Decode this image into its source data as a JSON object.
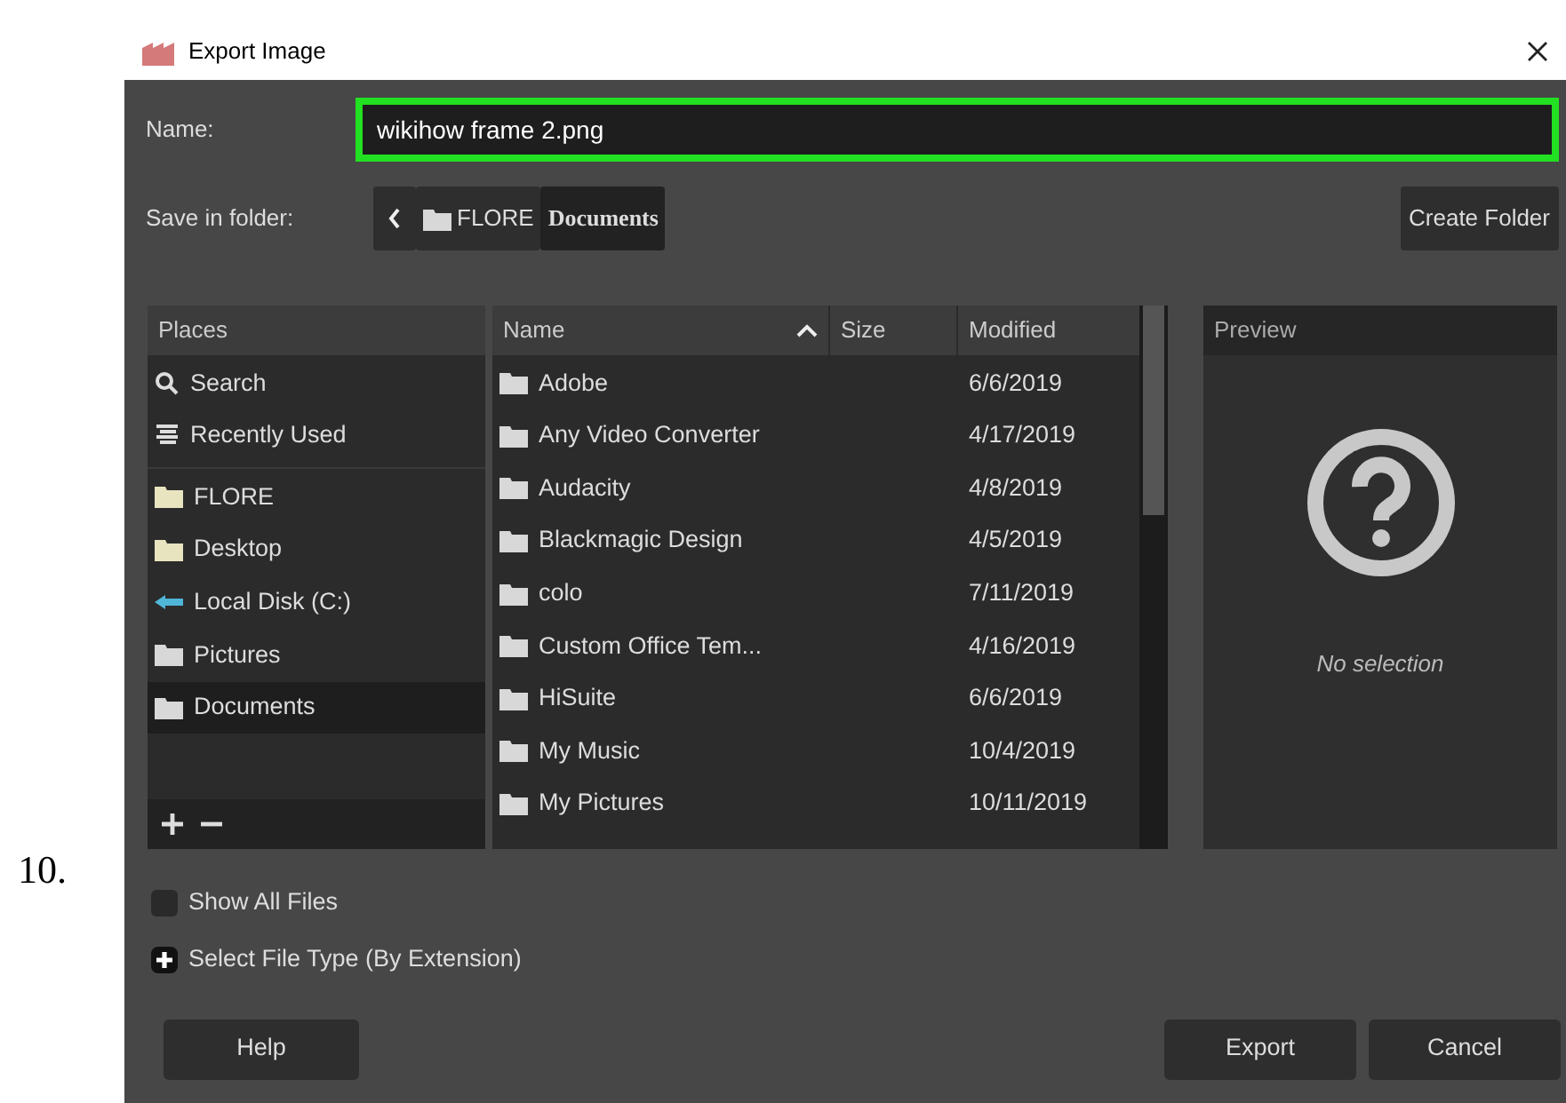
{
  "step_number": "10.",
  "window": {
    "title": "Export Image"
  },
  "name_field": {
    "label": "Name:",
    "value": "wikihow frame 2.png",
    "focused": true
  },
  "folder_bar": {
    "label": "Save in folder:",
    "path": [
      {
        "label": "FLORE",
        "kind": "folder",
        "selected": false
      },
      {
        "label": "Documents",
        "kind": "plain",
        "selected": true
      }
    ],
    "create_button": "Create Folder"
  },
  "places": {
    "header": "Places",
    "groups": [
      [
        {
          "label": "Search",
          "kind": "search",
          "selected": false
        },
        {
          "label": "Recently Used",
          "kind": "recent",
          "selected": false
        }
      ],
      [
        {
          "label": "FLORE",
          "kind": "home",
          "selected": false
        },
        {
          "label": "Desktop",
          "kind": "home",
          "selected": false
        },
        {
          "label": "Local Disk (C:)",
          "kind": "drive",
          "selected": false
        },
        {
          "label": "Pictures",
          "kind": "folder",
          "selected": false
        },
        {
          "label": "Documents",
          "kind": "folder",
          "selected": true
        }
      ]
    ]
  },
  "files": {
    "columns": [
      "Name",
      "Size",
      "Modified"
    ],
    "rows": [
      {
        "name": "Adobe",
        "modified": "6/6/2019"
      },
      {
        "name": "Any Video Converter",
        "modified": "4/17/2019"
      },
      {
        "name": "Audacity",
        "modified": "4/8/2019"
      },
      {
        "name": "Blackmagic Design",
        "modified": "4/5/2019"
      },
      {
        "name": "colo",
        "modified": "7/11/2019"
      },
      {
        "name": "Custom Office Tem...",
        "modified": "4/16/2019"
      },
      {
        "name": "HiSuite",
        "modified": "6/6/2019"
      },
      {
        "name": "My Music",
        "modified": "10/4/2019"
      },
      {
        "name": "My Pictures",
        "modified": "10/11/2019"
      }
    ]
  },
  "preview": {
    "header": "Preview",
    "message": "No selection"
  },
  "show_all_files": {
    "label": "Show All Files",
    "checked": false
  },
  "file_type": {
    "label": "Select File Type (By Extension)",
    "expanded": false
  },
  "buttons": {
    "help": "Help",
    "export": "Export",
    "cancel": "Cancel"
  }
}
